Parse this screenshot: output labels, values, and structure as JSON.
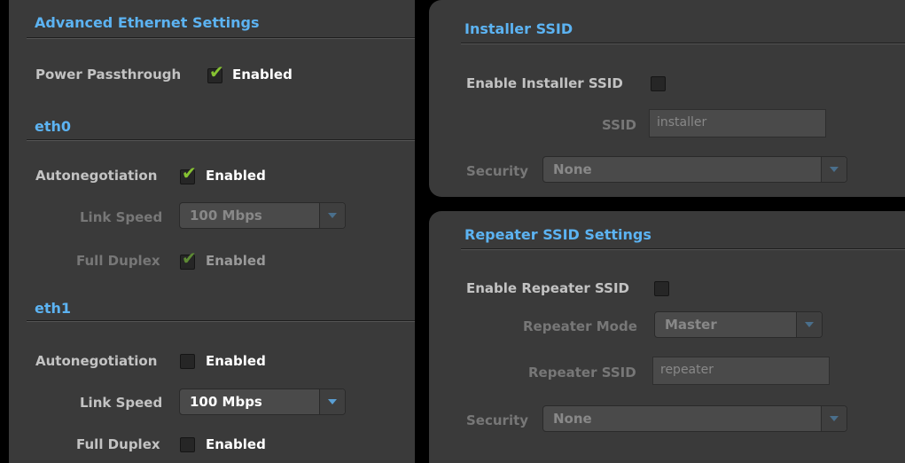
{
  "advanced": {
    "title": "Advanced Ethernet Settings",
    "power_passthrough": {
      "label": "Power Passthrough",
      "checked": true,
      "value": "Enabled"
    },
    "eth0": {
      "title": "eth0",
      "autonegotiation": {
        "label": "Autonegotiation",
        "checked": true,
        "value": "Enabled"
      },
      "link_speed": {
        "label": "Link Speed",
        "value": "100 Mbps"
      },
      "full_duplex": {
        "label": "Full Duplex",
        "checked": true,
        "value": "Enabled"
      }
    },
    "eth1": {
      "title": "eth1",
      "autonegotiation": {
        "label": "Autonegotiation",
        "checked": false,
        "value": "Enabled"
      },
      "link_speed": {
        "label": "Link Speed",
        "value": "100 Mbps"
      },
      "full_duplex": {
        "label": "Full Duplex",
        "checked": false,
        "value": "Enabled"
      }
    }
  },
  "installer": {
    "title": "Installer SSID",
    "enable": {
      "label": "Enable Installer SSID",
      "checked": false
    },
    "ssid": {
      "label": "SSID",
      "value": "installer"
    },
    "security": {
      "label": "Security",
      "value": "None"
    }
  },
  "repeater": {
    "title": "Repeater SSID Settings",
    "enable": {
      "label": "Enable Repeater SSID",
      "checked": false
    },
    "mode": {
      "label": "Repeater Mode",
      "value": "Master"
    },
    "ssid": {
      "label": "Repeater SSID",
      "value": "repeater"
    },
    "security": {
      "label": "Security",
      "value": "None"
    }
  },
  "colors": {
    "accent": "#5cb3f2",
    "check": "#86c232",
    "panel": "#3a3a3a",
    "background": "#000000"
  },
  "icons": {
    "checkmark": "check-icon",
    "dropdown": "chevron-down-icon"
  }
}
